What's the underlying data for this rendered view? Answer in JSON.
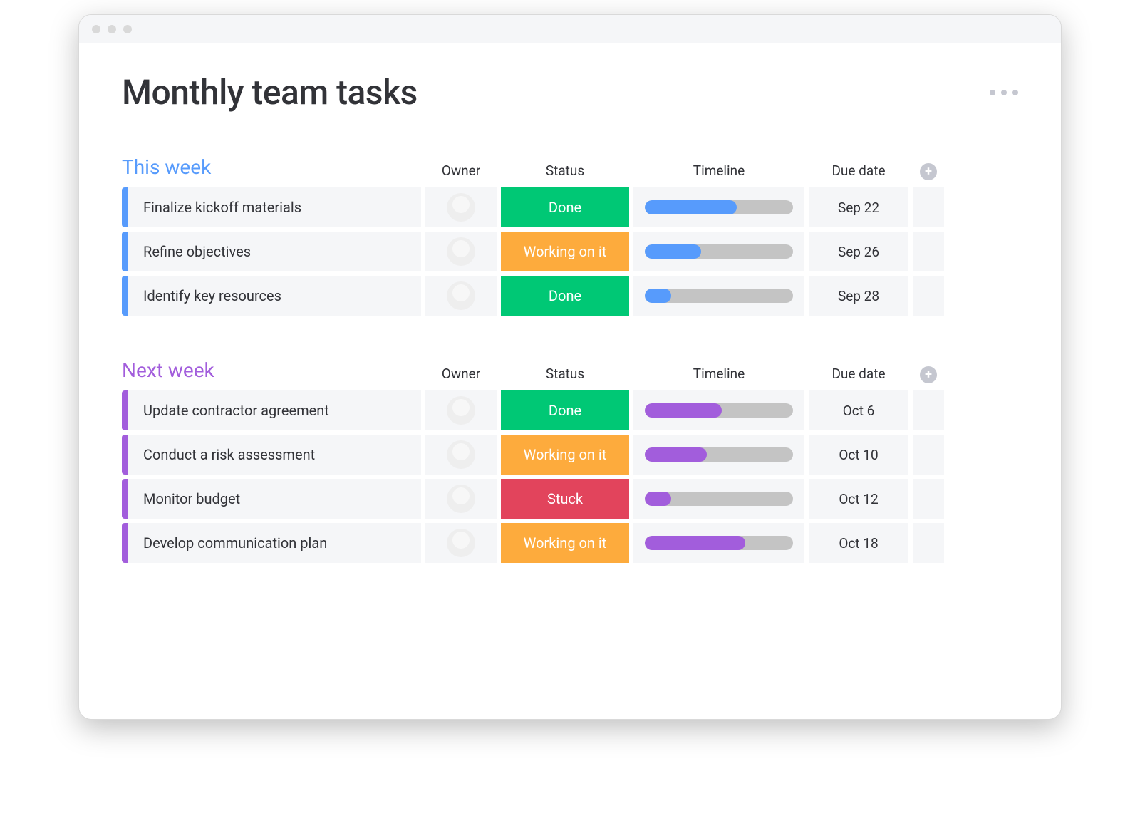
{
  "page": {
    "title": "Monthly team tasks"
  },
  "columns": {
    "owner": "Owner",
    "status": "Status",
    "timeline": "Timeline",
    "due": "Due date"
  },
  "status_colors": {
    "done": "#00c875",
    "working": "#fdab3d",
    "stuck": "#e2445c"
  },
  "groups": [
    {
      "title": "This week",
      "color": "#579bfc",
      "rows": [
        {
          "name": "Finalize kickoff materials",
          "owner_avatar": "av1",
          "status_key": "done",
          "status_label": "Done",
          "progress": 62,
          "due": "Sep 22"
        },
        {
          "name": "Refine objectives",
          "owner_avatar": "av2",
          "status_key": "working",
          "status_label": "Working on it",
          "progress": 38,
          "due": "Sep 26"
        },
        {
          "name": "Identify key resources",
          "owner_avatar": "av3",
          "status_key": "done",
          "status_label": "Done",
          "progress": 18,
          "due": "Sep 28"
        }
      ]
    },
    {
      "title": "Next week",
      "color": "#a25ddc",
      "rows": [
        {
          "name": "Update contractor agreement",
          "owner_avatar": "av4",
          "status_key": "done",
          "status_label": "Done",
          "progress": 52,
          "due": "Oct 6"
        },
        {
          "name": "Conduct a risk assessment",
          "owner_avatar": "av2",
          "status_key": "working",
          "status_label": "Working on it",
          "progress": 42,
          "due": "Oct 10"
        },
        {
          "name": "Monitor budget",
          "owner_avatar": "av5",
          "status_key": "stuck",
          "status_label": "Stuck",
          "progress": 18,
          "due": "Oct 12"
        },
        {
          "name": "Develop communication plan",
          "owner_avatar": "av6",
          "status_key": "working",
          "status_label": "Working on it",
          "progress": 68,
          "due": "Oct 18"
        }
      ]
    }
  ]
}
